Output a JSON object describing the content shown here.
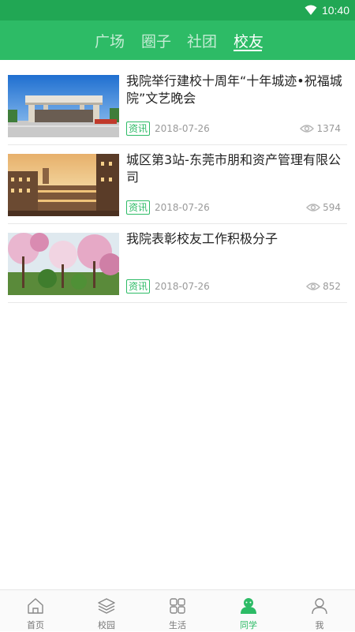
{
  "status_bar": {
    "time": "10:40"
  },
  "top_tabs": [
    {
      "label": "广场",
      "active": false
    },
    {
      "label": "圈子",
      "active": false
    },
    {
      "label": "社团",
      "active": false
    },
    {
      "label": "校友",
      "active": true
    }
  ],
  "articles": [
    {
      "title": "我院举行建校十周年“十年城迹•祝福城院”文艺晚会",
      "tag": "资讯",
      "date": "2018-07-26",
      "views": "1374",
      "image": "campus-gate-photo"
    },
    {
      "title": "城区第3站-东莞市朋和资产管理有限公司",
      "tag": "资讯",
      "date": "2018-07-26",
      "views": "594",
      "image": "campus-building-sunset-photo"
    },
    {
      "title": "我院表彰校友工作积极分子",
      "tag": "资讯",
      "date": "2018-07-26",
      "views": "852",
      "image": "magnolia-trees-photo"
    }
  ],
  "bottom_tabs": [
    {
      "label": "首页",
      "icon": "home-icon",
      "active": false
    },
    {
      "label": "校园",
      "icon": "layers-icon",
      "active": false
    },
    {
      "label": "生活",
      "icon": "grid-icon",
      "active": false
    },
    {
      "label": "同学",
      "icon": "classmates-icon",
      "active": true
    },
    {
      "label": "我",
      "icon": "person-icon",
      "active": false
    }
  ],
  "colors": {
    "brand_green": "#2dbb66",
    "status_green": "#21a754"
  }
}
